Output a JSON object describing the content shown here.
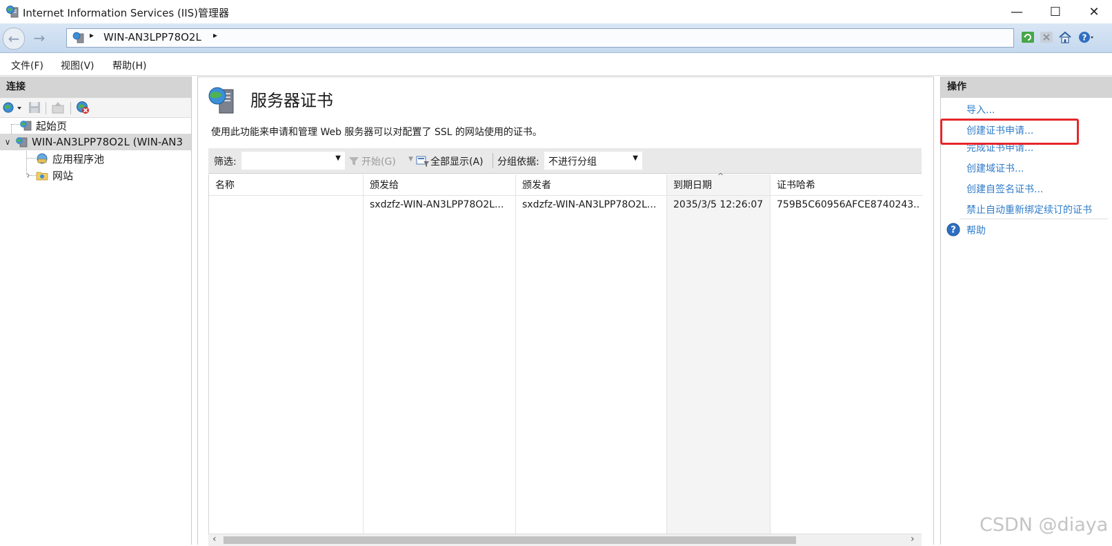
{
  "window": {
    "title": "Internet Information Services (IIS)管理器",
    "minimize_glyph": "—",
    "maximize_glyph": "☐",
    "close_glyph": "✕"
  },
  "address": {
    "back_glyph": "←",
    "forward_glyph": "→",
    "sep_glyph": "▸",
    "server": "WIN-AN3LPP78O2L",
    "trailing_glyph": "▸"
  },
  "menu": {
    "file": "文件(F)",
    "view": "视图(V)",
    "help": "帮助(H)"
  },
  "connections": {
    "header": "连接",
    "tree": [
      {
        "label": "起始页",
        "icon": "start-page-icon"
      },
      {
        "label": "WIN-AN3LPP78O2L (WIN-AN3",
        "icon": "server-icon",
        "toggle": "∨"
      },
      {
        "label": "应用程序池",
        "icon": "app-pool-icon"
      },
      {
        "label": "网站",
        "icon": "sites-folder-icon",
        "toggle": "›"
      }
    ]
  },
  "main": {
    "title": "服务器证书",
    "description": "使用此功能来申请和管理 Web 服务器可以对配置了 SSL 的网站使用的证书。",
    "filter": {
      "label": "筛选:",
      "value": "",
      "start": "开始(G)",
      "show_all": "全部显示(A)",
      "group_label": "分组依据:",
      "group_value": "不进行分组"
    },
    "columns": [
      "名称",
      "颁发给",
      "颁发者",
      "到期日期",
      "证书哈希"
    ],
    "rows": [
      [
        "",
        "sxdzfz-WIN-AN3LPP78O2L...",
        "sxdzfz-WIN-AN3LPP78O2L...",
        "2035/3/5 12:26:07",
        "759B5C60956AFCE8740243..."
      ]
    ],
    "sort_glyph": "^",
    "scroll_left_glyph": "‹",
    "scroll_right_glyph": "›"
  },
  "actions": {
    "header": "操作",
    "items": [
      "导入...",
      "创建证书申请...",
      "完成证书申请...",
      "创建域证书...",
      "创建自签名证书...",
      "禁止自动重新绑定续订的证书",
      "帮助"
    ],
    "help_glyph": "?"
  },
  "watermark": "CSDN @diaya",
  "colors": {
    "link": "#2f7cc9",
    "highlight": "#e6262a",
    "panel_header": "#d4d4d4"
  }
}
